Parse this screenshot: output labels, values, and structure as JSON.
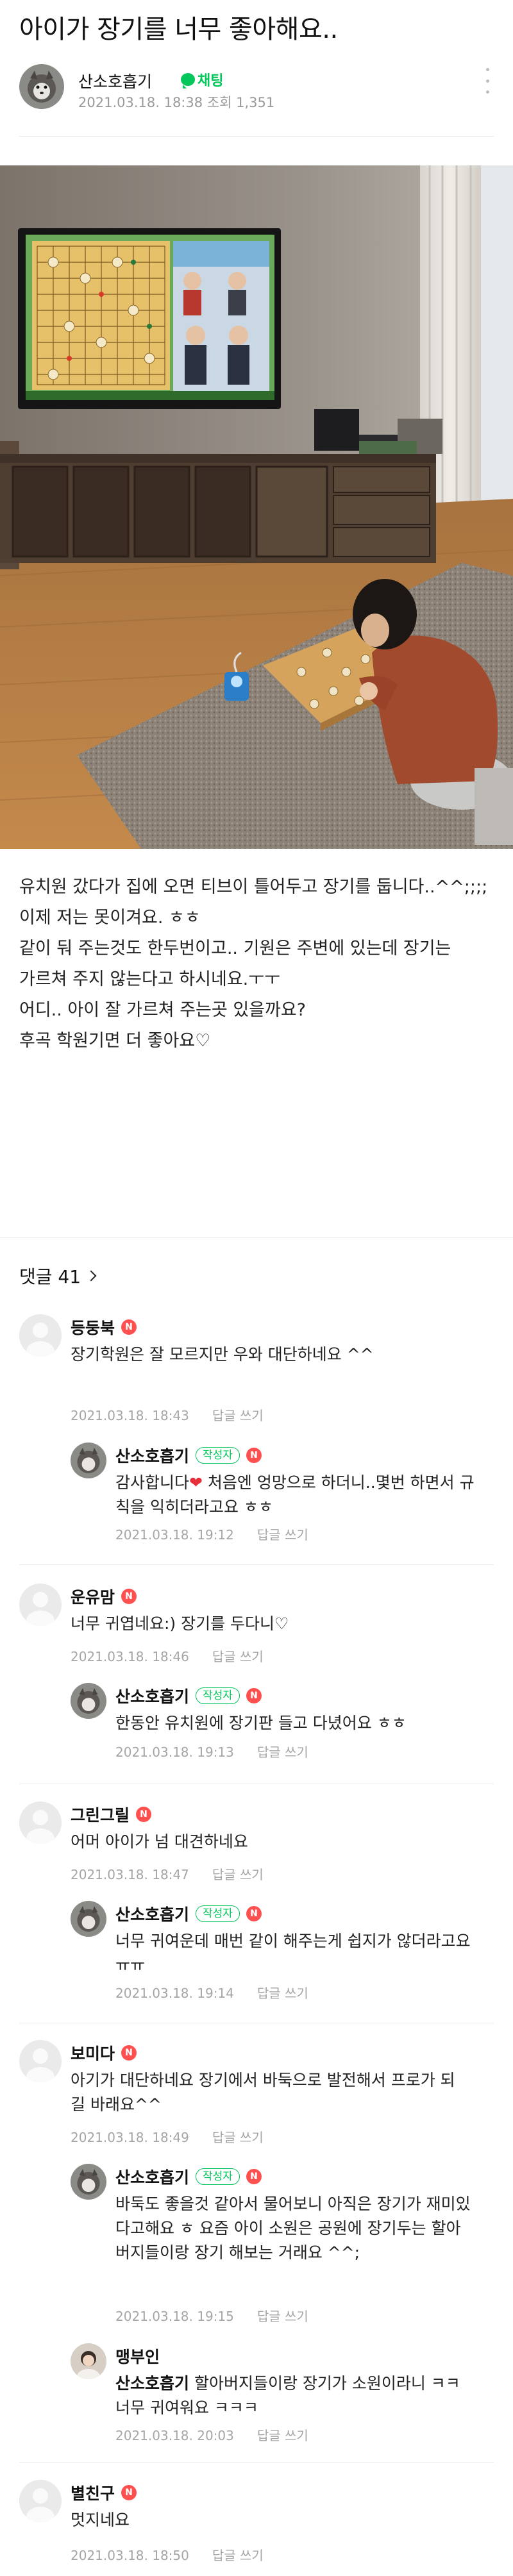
{
  "post": {
    "title": "아이가 장기를 너무 좋아해요..",
    "author": "산소호흡기",
    "chat_label": "채팅",
    "meta": "2021.03.18. 18:38 조회 1,351",
    "body_lines": [
      "유치원 갔다가 집에 오면 티브이 틀어두고 장기를 둡니다..^^;;;;",
      "이제 저는 못이겨요. ㅎㅎ",
      "같이 둬 주는것도 한두번이고.. 기원은 주변에 있는데 장기는 가르쳐 주지 않는다고 하시네요.ㅜㅜ",
      "어디.. 아이 잘 가르쳐 주는곳 있을까요?",
      "후곡 학원기면 더 좋아요♡"
    ]
  },
  "comments_header": {
    "label": "댓글 41"
  },
  "labels": {
    "writer_badge": "작성자",
    "reply": "답글 쓰기",
    "new_badge": "N"
  },
  "comments": [
    {
      "name": "등둥북",
      "text": "장기학원은 잘 모르지만 우와 대단하네요 ^^",
      "time": "2021.03.18. 18:43"
    },
    {
      "name": "산소호흡기",
      "text_before": "감사합니다",
      "text_after": " 처음엔 엉망으로 하더니..몇번 하면서 규칙을 익히더라고요 ㅎㅎ",
      "time": "2021.03.18. 19:12"
    },
    {
      "name": "운유맘",
      "text": "너무 귀엽네요:) 장기를 두다니♡",
      "time": "2021.03.18. 18:46"
    },
    {
      "name": "산소호흡기",
      "text": "한동안 유치원에 장기판 들고 다녔어요 ㅎㅎ",
      "time": "2021.03.18. 19:13"
    },
    {
      "name": "그린그릴",
      "text": "어머 아이가 넘 대견하네요",
      "time": "2021.03.18. 18:47"
    },
    {
      "name": "산소호흡기",
      "text": "너무 귀여운데 매번 같이 해주는게 쉽지가 않더라고요 ㅠㅠ",
      "time": "2021.03.18. 19:14"
    },
    {
      "name": "보미다",
      "text": "아기가 대단하네요 장기에서 바둑으로 발전해서 프로가 되길 바래요^^",
      "time": "2021.03.18. 18:49"
    },
    {
      "name": "산소호흡기",
      "text": "바둑도 좋을것 같아서 물어보니 아직은 장기가 재미있다고해요 ㅎ 요즘 아이 소원은 공원에 장기두는 할아버지들이랑 장기 해보는 거래요 ^^;",
      "time": "2021.03.18. 19:15"
    },
    {
      "name": "맹부인",
      "mention": "산소호흡기",
      "text": " 할아버지들이랑 장기가 소원이라니 ㅋㅋ 너무 귀여워요 ㅋㅋㅋ",
      "time": "2021.03.18. 20:03"
    },
    {
      "name": "별친구",
      "text": "멋지네요",
      "time": "2021.03.18. 18:50"
    }
  ],
  "icons": {
    "chat": "chat-bubble-icon",
    "more": "more-vertical-icon",
    "heart": "heart-icon",
    "new": "new-badge-icon"
  },
  "colors": {
    "green": "#03c75a",
    "new_badge": "#ff5050",
    "meta_gray": "#a5a5a5",
    "heart": "#e5303b"
  }
}
